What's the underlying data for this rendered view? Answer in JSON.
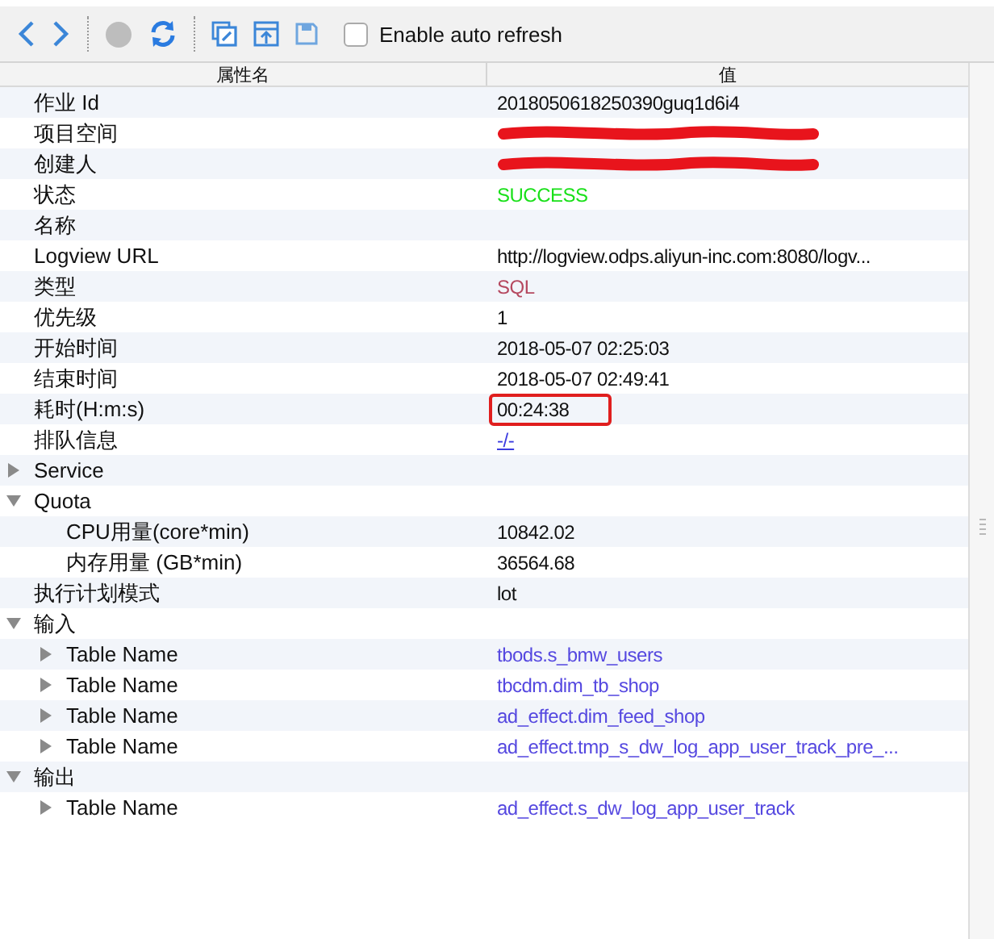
{
  "toolbar": {
    "auto_refresh": {
      "label": "Enable auto refresh",
      "checked": false
    }
  },
  "table": {
    "columns": [
      "属性名",
      "值"
    ],
    "rows": [
      {
        "name": "作业 Id",
        "value": "2018050618250390guq1d6i4",
        "kind": "text"
      },
      {
        "name": "项目空间",
        "redacted": true
      },
      {
        "name": "创建人",
        "redacted": true
      },
      {
        "name": "状态",
        "value": "SUCCESS",
        "kind": "status"
      },
      {
        "name": "名称"
      },
      {
        "name": "Logview URL",
        "value": "http://logview.odps.aliyun-inc.com:8080/logv...",
        "kind": "text"
      },
      {
        "name": "类型",
        "value": "SQL",
        "kind": "type"
      },
      {
        "name": "优先级",
        "value": "1",
        "kind": "text"
      },
      {
        "name": "开始时间",
        "value": "2018-05-07 02:25:03",
        "kind": "text"
      },
      {
        "name": "结束时间",
        "value": "2018-05-07 02:49:41",
        "kind": "text"
      },
      {
        "name": "耗时(H:m:s)",
        "value": "00:24:38",
        "kind": "text",
        "highlighted": true
      },
      {
        "name": "排队信息",
        "value": "-/-",
        "kind": "link"
      },
      {
        "name": "Service",
        "expanded": false
      },
      {
        "name": "Quota",
        "expanded": true,
        "children": [
          {
            "name": "CPU用量(core*min)",
            "value": "10842.02",
            "kind": "text"
          },
          {
            "name": "内存用量 (GB*min)",
            "value": "36564.68",
            "kind": "text"
          }
        ]
      },
      {
        "name": "执行计划模式",
        "value": "lot",
        "kind": "text"
      },
      {
        "name": "输入",
        "expanded": true,
        "children": [
          {
            "name": "Table Name",
            "value": "tbods.s_bmw_users",
            "kind": "table",
            "expanded": false
          },
          {
            "name": "Table Name",
            "value": "tbcdm.dim_tb_shop",
            "kind": "table",
            "expanded": false
          },
          {
            "name": "Table Name",
            "value": "ad_effect.dim_feed_shop",
            "kind": "table",
            "expanded": false
          },
          {
            "name": "Table Name",
            "value": "ad_effect.tmp_s_dw_log_app_user_track_pre_...",
            "kind": "table",
            "expanded": false
          }
        ]
      },
      {
        "name": "输出",
        "expanded": true,
        "children": [
          {
            "name": "Table Name",
            "value": "ad_effect.s_dw_log_app_user_track",
            "kind": "table",
            "expanded": false
          }
        ]
      }
    ]
  }
}
